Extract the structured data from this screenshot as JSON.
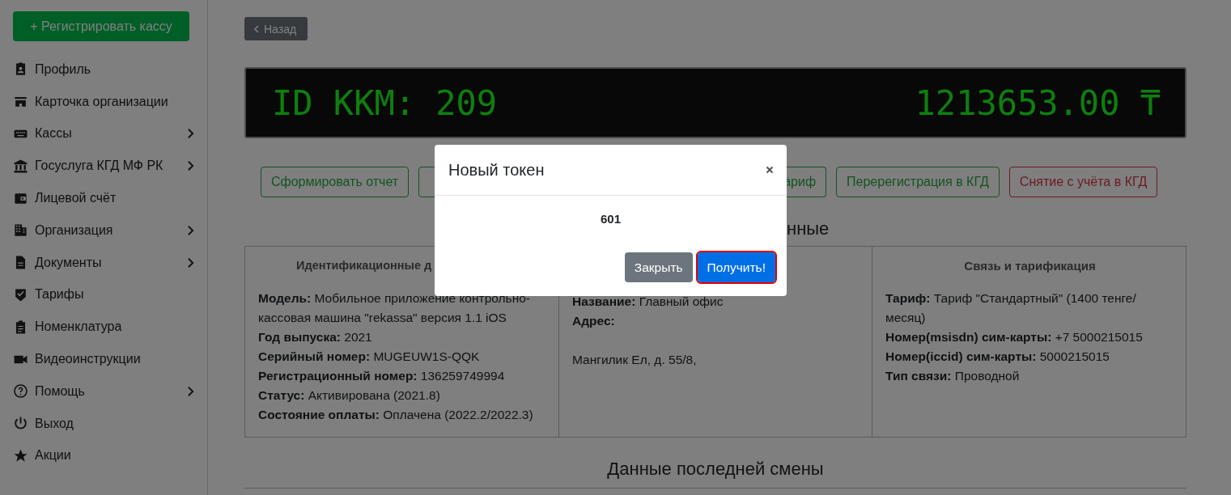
{
  "sidebar": {
    "register_button": "+ Регистрировать кассу",
    "items": [
      {
        "label": "Профиль",
        "expandable": false
      },
      {
        "label": "Карточка организации",
        "expandable": false
      },
      {
        "label": "Кассы",
        "expandable": true
      },
      {
        "label": "Госуслуга КГД МФ РК",
        "expandable": true
      },
      {
        "label": "Лицевой счёт",
        "expandable": false
      },
      {
        "label": "Организация",
        "expandable": true
      },
      {
        "label": "Документы",
        "expandable": true
      },
      {
        "label": "Тарифы",
        "expandable": false
      },
      {
        "label": "Номенклатура",
        "expandable": false
      },
      {
        "label": "Видеоинструкции",
        "expandable": false
      },
      {
        "label": "Помощь",
        "expandable": true
      },
      {
        "label": "Выход",
        "expandable": false
      },
      {
        "label": "Акции",
        "expandable": false
      }
    ]
  },
  "back_button": "Назад",
  "display": {
    "id": "ID KKM: 209",
    "amount": "1213653.00 ₸"
  },
  "actions": [
    {
      "label": "Сформировать отчет",
      "kind": "success",
      "obscured": false
    },
    {
      "kind": "success",
      "obscured": true
    },
    {
      "label": "ариф",
      "kind": "success",
      "obscured": false
    },
    {
      "label": "Перерегистрация в КГД",
      "kind": "success",
      "obscured": false
    },
    {
      "label": "Снятие с учёта в КГД",
      "kind": "danger",
      "obscured": false
    }
  ],
  "section_heading": "нные",
  "info_columns": [
    {
      "heading": "Идентификационные д",
      "fields": [
        {
          "kind": "field",
          "text": "**Модель:** Мобильное приложение контрольно-кассовая машина \"rekassa\" версия 1.1 iOS"
        },
        {
          "kind": "field",
          "text": "**Год выпуска:** 2021"
        },
        {
          "kind": "field",
          "text": "**Серийный номер:** MUGEUW1S-QQK"
        },
        {
          "kind": "field",
          "text": "**Регистрационный номер:** 136259749994"
        },
        {
          "kind": "field",
          "text": "**Статус:** Активирована (2021.8)"
        },
        {
          "kind": "field",
          "text": "**Состояние оплаты:** Оплачена (2022.2/2022.3)"
        }
      ]
    },
    {
      "fields": [
        {
          "kind": "field",
          "text": "**Название:** Главный офис"
        },
        {
          "kind": "field",
          "text": "**Адрес:**"
        },
        {
          "kind": "note",
          "text": "Мангилик Ел, д. 55/8,"
        }
      ]
    },
    {
      "heading": "Связь и тарификация",
      "fields": [
        {
          "kind": "field",
          "text": "**Тариф:** Тариф \"Стандартный\" (1400 тенге/месяц)"
        },
        {
          "kind": "field",
          "text": "**Номер(msisdn) сим-карты:** +7 5000215015"
        },
        {
          "kind": "field",
          "text": "**Номер(iccid) сим-карты:** 5000215015"
        },
        {
          "kind": "field",
          "text": "**Тип связи:** Проводной"
        }
      ]
    }
  ],
  "last_shift_heading": "Данные последней смены",
  "modal": {
    "title": "Новый токен",
    "token": "601",
    "buttons": [
      {
        "label": "Закрыть",
        "kind": "secondary",
        "focused": false
      },
      {
        "label": "Получить!",
        "kind": "primary",
        "focused": true
      }
    ]
  }
}
